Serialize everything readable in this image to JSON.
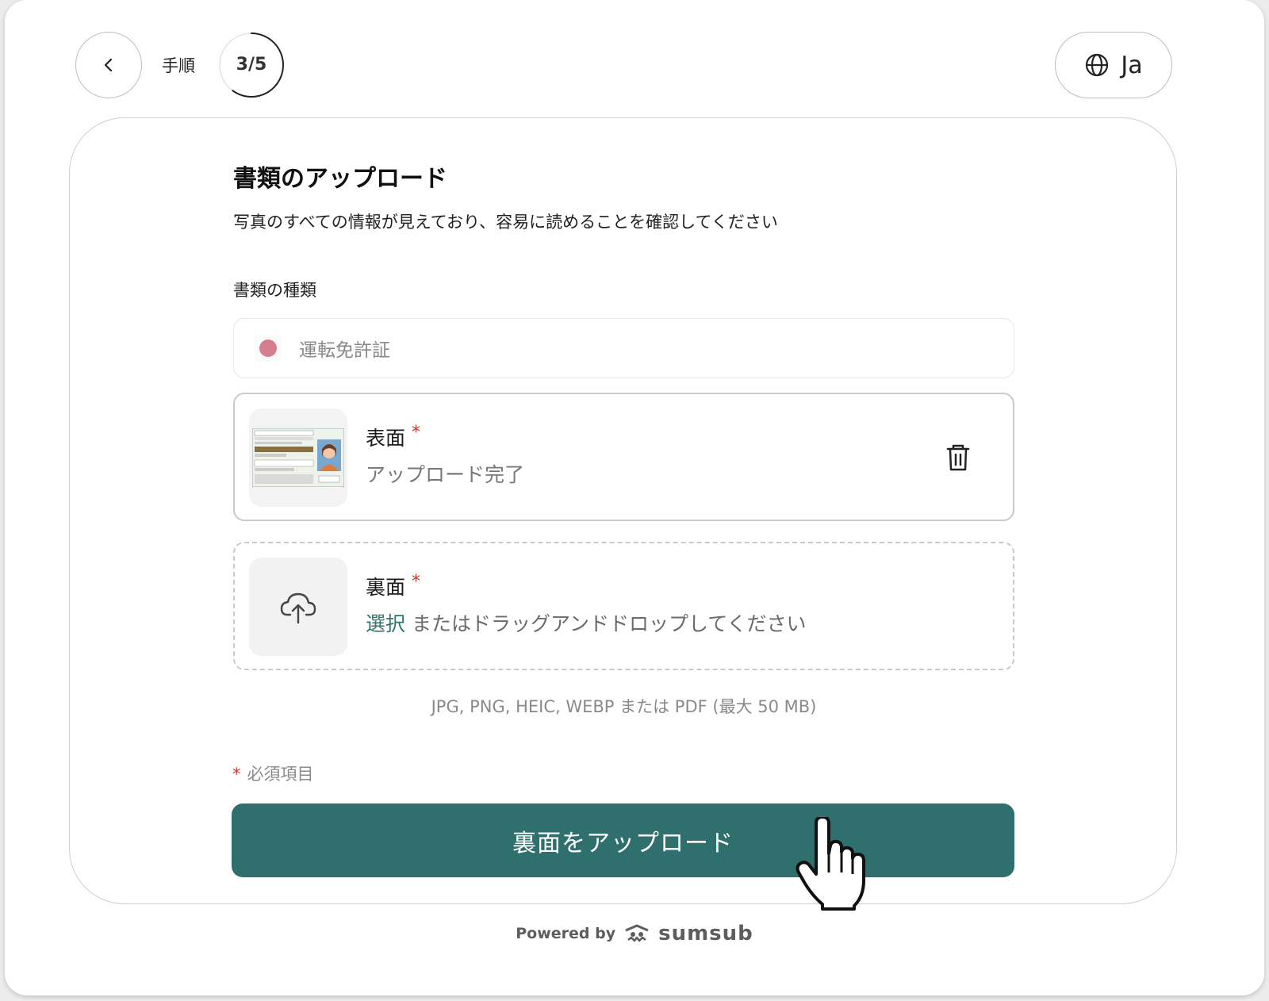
{
  "header": {
    "step_label": "手順",
    "step_counter": "3/5",
    "step_progress": 0.6,
    "language": "Ja"
  },
  "main": {
    "title": "書類のアップロード",
    "subtitle": "写真のすべての情報が見えており、容易に読めることを確認してください",
    "document_type_label": "書類の種類",
    "document_type_value": "運転免許証",
    "front": {
      "title": "表面",
      "required_mark": "*",
      "status": "アップロード完了"
    },
    "back": {
      "title": "裏面",
      "required_mark": "*",
      "select_link": "選択",
      "drop_text": " またはドラッグアンドドロップしてください"
    },
    "file_hint": "JPG, PNG, HEIC, WEBP または PDF (最大 50 MB)",
    "required_note_mark": "*",
    "required_note": "必須項目",
    "upload_button": "裏面をアップロード"
  },
  "footer": {
    "powered_by": "Powered by",
    "brand": "sumsub"
  },
  "colors": {
    "primary": "#2f6f6d",
    "link": "#2d7672",
    "required": "#c0392b",
    "flag_dot": "#d67e8c"
  }
}
